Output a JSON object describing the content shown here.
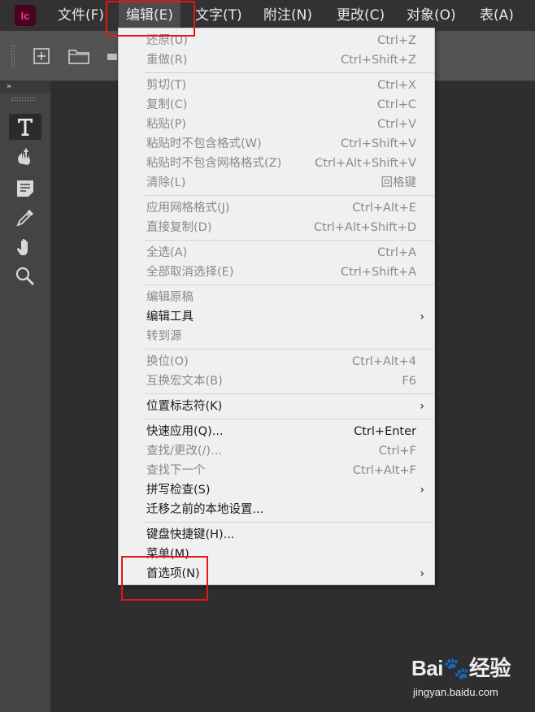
{
  "app": {
    "logo_text": "Ic",
    "logo_bg": "#49021f",
    "logo_fg": "#ff3c8d"
  },
  "menubar": {
    "items": [
      {
        "label": "文件(F)"
      },
      {
        "label": "编辑(E)",
        "active": true
      },
      {
        "label": "文字(T)"
      },
      {
        "label": "附注(N)"
      },
      {
        "label": "更改(C)"
      },
      {
        "label": "对象(O)"
      },
      {
        "label": "表(A)"
      }
    ]
  },
  "toolbar": {
    "icons": [
      "new-frame-icon",
      "open-folder-icon",
      "place-icon"
    ]
  },
  "tools_panel": {
    "collapse_glyph": "»",
    "tools": [
      "type-tool-icon",
      "position-tool-icon",
      "note-tool-icon",
      "eyedropper-tool-icon",
      "hand-tool-icon",
      "zoom-tool-icon"
    ]
  },
  "edit_menu": {
    "groups": [
      [
        {
          "label": "还原(U)",
          "shortcut": "Ctrl+Z",
          "enabled": false
        },
        {
          "label": "重做(R)",
          "shortcut": "Ctrl+Shift+Z",
          "enabled": false
        }
      ],
      [
        {
          "label": "剪切(T)",
          "shortcut": "Ctrl+X",
          "enabled": false
        },
        {
          "label": "复制(C)",
          "shortcut": "Ctrl+C",
          "enabled": false
        },
        {
          "label": "粘贴(P)",
          "shortcut": "Ctrl+V",
          "enabled": false
        },
        {
          "label": "粘贴时不包含格式(W)",
          "shortcut": "Ctrl+Shift+V",
          "enabled": false
        },
        {
          "label": "粘贴时不包含网格格式(Z)",
          "shortcut": "Ctrl+Alt+Shift+V",
          "enabled": false
        },
        {
          "label": "清除(L)",
          "shortcut": "回格键",
          "enabled": false
        }
      ],
      [
        {
          "label": "应用网格格式(J)",
          "shortcut": "Ctrl+Alt+E",
          "enabled": false
        },
        {
          "label": "直接复制(D)",
          "shortcut": "Ctrl+Alt+Shift+D",
          "enabled": false
        }
      ],
      [
        {
          "label": "全选(A)",
          "shortcut": "Ctrl+A",
          "enabled": false
        },
        {
          "label": "全部取消选择(E)",
          "shortcut": "Ctrl+Shift+A",
          "enabled": false
        }
      ],
      [
        {
          "label": "编辑原稿",
          "shortcut": "",
          "enabled": false
        },
        {
          "label": "编辑工具",
          "shortcut": "",
          "enabled": true,
          "submenu": true
        },
        {
          "label": "转到源",
          "shortcut": "",
          "enabled": false
        }
      ],
      [
        {
          "label": "换位(O)",
          "shortcut": "Ctrl+Alt+4",
          "enabled": false
        },
        {
          "label": "互换宏文本(B)",
          "shortcut": "F6",
          "enabled": false
        }
      ],
      [
        {
          "label": "位置标志符(K)",
          "shortcut": "",
          "enabled": true,
          "submenu": true
        }
      ],
      [
        {
          "label": "快速应用(Q)...",
          "shortcut": "Ctrl+Enter",
          "enabled": true
        },
        {
          "label": "查找/更改(/)...",
          "shortcut": "Ctrl+F",
          "enabled": false
        },
        {
          "label": "查找下一个",
          "shortcut": "Ctrl+Alt+F",
          "enabled": false
        },
        {
          "label": "拼写检查(S)",
          "shortcut": "",
          "enabled": true,
          "submenu": true
        },
        {
          "label": "迁移之前的本地设置...",
          "shortcut": "",
          "enabled": true
        }
      ],
      [
        {
          "label": "键盘快捷键(H)...",
          "shortcut": "",
          "enabled": true
        },
        {
          "label": "菜单(M)...",
          "shortcut": "",
          "enabled": true
        },
        {
          "label": "首选项(N)",
          "shortcut": "",
          "enabled": true,
          "submenu": true
        }
      ]
    ],
    "submenu_glyph": "›"
  },
  "highlight_color": "#e01818",
  "watermark": {
    "logo": "Bai🐾经验",
    "url": "jingyan.baidu.com"
  }
}
